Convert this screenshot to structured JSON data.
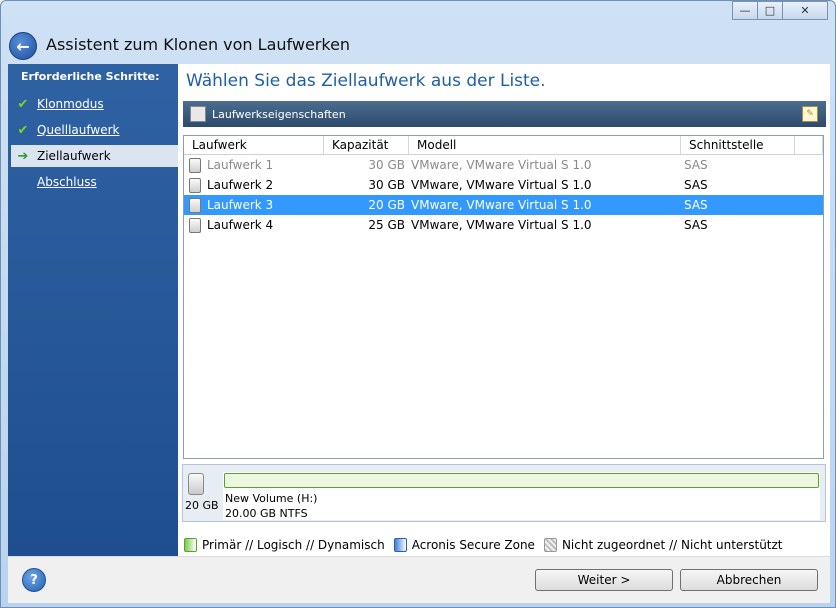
{
  "window": {
    "title": "Assistent zum Klonen von Laufwerken",
    "minimize_glyph": "—",
    "maximize_glyph": "□",
    "close_glyph": "✕",
    "back_glyph": "←"
  },
  "sidebar": {
    "heading": "Erforderliche Schritte:",
    "steps": [
      {
        "label": "Klonmodus",
        "status": "done",
        "mark": "✔"
      },
      {
        "label": "Quelllaufwerk",
        "status": "done",
        "mark": "✔"
      },
      {
        "label": "Ziellaufwerk",
        "status": "current",
        "mark": "➔"
      },
      {
        "label": "Abschluss",
        "status": "pending",
        "mark": ""
      }
    ]
  },
  "main": {
    "heading": "Wählen Sie das Ziellaufwerk aus der Liste.",
    "properties_label": "Laufwerkseigenschaften",
    "columns": [
      "Laufwerk",
      "Kapazität",
      "Modell",
      "Schnittstelle"
    ],
    "rows": [
      {
        "name": "Laufwerk 1",
        "capacity": "30 GB",
        "model": "VMware, VMware Virtual S 1.0",
        "interface": "SAS",
        "state": "disabled"
      },
      {
        "name": "Laufwerk 2",
        "capacity": "30 GB",
        "model": "VMware, VMware Virtual S 1.0",
        "interface": "SAS",
        "state": "normal"
      },
      {
        "name": "Laufwerk 3",
        "capacity": "20 GB",
        "model": "VMware, VMware Virtual S 1.0",
        "interface": "SAS",
        "state": "selected"
      },
      {
        "name": "Laufwerk 4",
        "capacity": "25 GB",
        "model": "VMware, VMware Virtual S 1.0",
        "interface": "SAS",
        "state": "normal"
      }
    ],
    "disk_panel": {
      "size": "20 GB",
      "partition_name": "New Volume (H:)",
      "partition_info": "20.00 GB  NTFS"
    },
    "legend": [
      {
        "label": "Primär // Logisch // Dynamisch",
        "kind": "primary"
      },
      {
        "label": "Acronis Secure Zone",
        "kind": "secure"
      },
      {
        "label": "Nicht zugeordnet // Nicht unterstützt",
        "kind": "unalloc"
      }
    ]
  },
  "footer": {
    "help_glyph": "?",
    "next_label": "Weiter >",
    "cancel_label": "Abbrechen"
  },
  "colors": {
    "selection": "#3399ff",
    "heading": "#1e5fa8",
    "sidebar": "#2f62a3"
  }
}
